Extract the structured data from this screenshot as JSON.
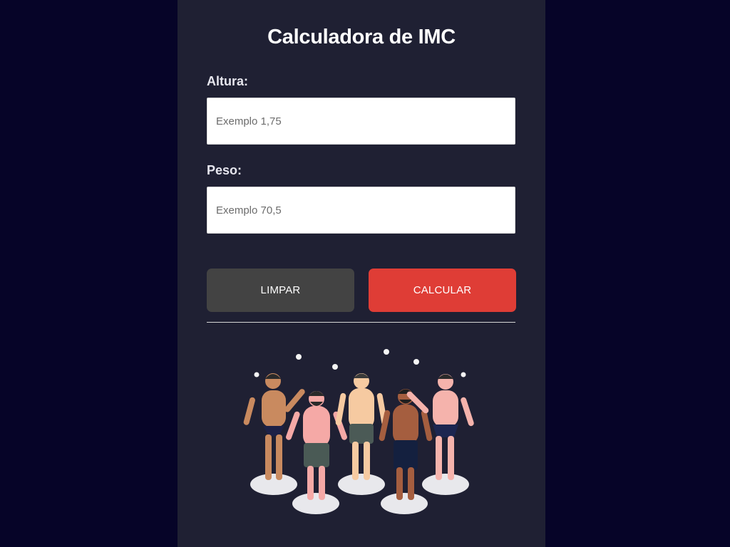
{
  "app": {
    "title": "Calculadora de IMC"
  },
  "form": {
    "height_label": "Altura:",
    "height_value": "",
    "height_placeholder": "Exemplo 1,75",
    "weight_label": "Peso:",
    "weight_value": "",
    "weight_placeholder": "Exemplo 70,5"
  },
  "buttons": {
    "clear_label": "LIMPAR",
    "calculate_label": "CALCULAR"
  },
  "colors": {
    "page_background": "#060428",
    "card_background": "#1f2033",
    "clear_button": "#434343",
    "calculate_button": "#df3d36"
  },
  "illustration": {
    "name": "group-of-people-illustration"
  }
}
